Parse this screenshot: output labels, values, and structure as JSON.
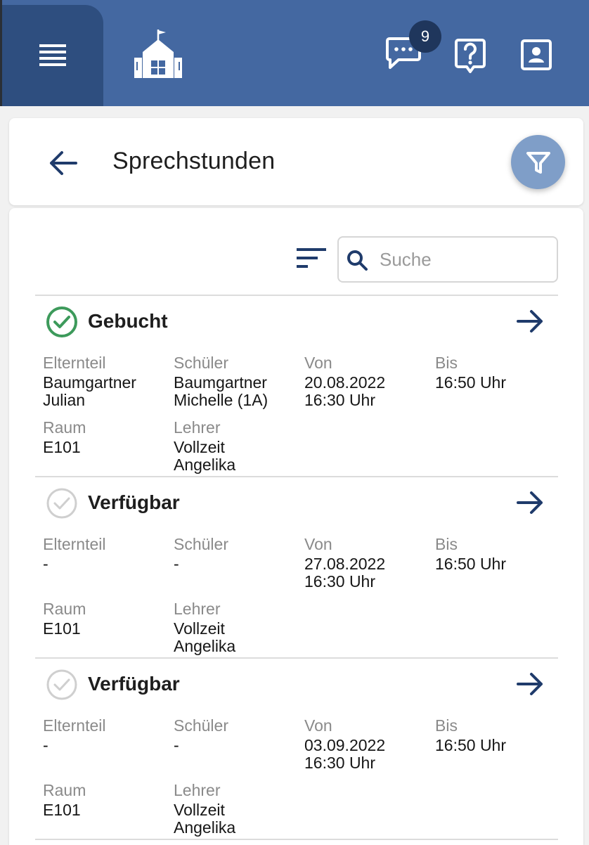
{
  "header": {
    "messages_badge": "9"
  },
  "page": {
    "title": "Sprechstunden"
  },
  "search": {
    "placeholder": "Suche"
  },
  "labels": {
    "parent": "Elternteil",
    "student": "Schüler",
    "from": "Von",
    "to": "Bis",
    "room": "Raum",
    "teacher": "Lehrer"
  },
  "entries": [
    {
      "status": "Gebucht",
      "status_type": "booked",
      "status_color": "#3d9a5b",
      "parent_line1": "Baumgartner",
      "parent_line2": "Julian",
      "student_line1": "Baumgartner",
      "student_line2": "Michelle (1A)",
      "from_date": "20.08.2022",
      "from_time": "16:30 Uhr",
      "to_time": "16:50 Uhr",
      "room": "E101",
      "teacher_line1": "Vollzeit",
      "teacher_line2": "Angelika"
    },
    {
      "status": "Verfügbar",
      "status_type": "available",
      "status_color": "#cfcfcf",
      "parent_line1": "-",
      "parent_line2": "",
      "student_line1": "-",
      "student_line2": "",
      "from_date": "27.08.2022",
      "from_time": "16:30 Uhr",
      "to_time": "16:50 Uhr",
      "room": "E101",
      "teacher_line1": "Vollzeit",
      "teacher_line2": "Angelika"
    },
    {
      "status": "Verfügbar",
      "status_type": "available",
      "status_color": "#cfcfcf",
      "parent_line1": "-",
      "parent_line2": "",
      "student_line1": "-",
      "student_line2": "",
      "from_date": "03.09.2022",
      "from_time": "16:30 Uhr",
      "to_time": "16:50 Uhr",
      "room": "E101",
      "teacher_line1": "Vollzeit",
      "teacher_line2": "Angelika"
    }
  ],
  "colors": {
    "header_bg": "#4468a1",
    "menu_bg": "#2e4e7f",
    "badge_bg": "#1f365c",
    "filter_bg": "#7f9ec8",
    "accent_dark": "#1f3b6b",
    "booked_green": "#3d9a5b"
  },
  "icons": {
    "menu": "menu-lines-icon",
    "logo": "school-building-icon",
    "messages": "chat-bubble-icon",
    "help": "help-question-icon",
    "profile": "contact-card-icon",
    "back": "arrow-left-icon",
    "filter": "funnel-filter-icon",
    "sort": "sort-lines-icon",
    "search": "magnifier-icon",
    "detail": "arrow-right-icon"
  }
}
